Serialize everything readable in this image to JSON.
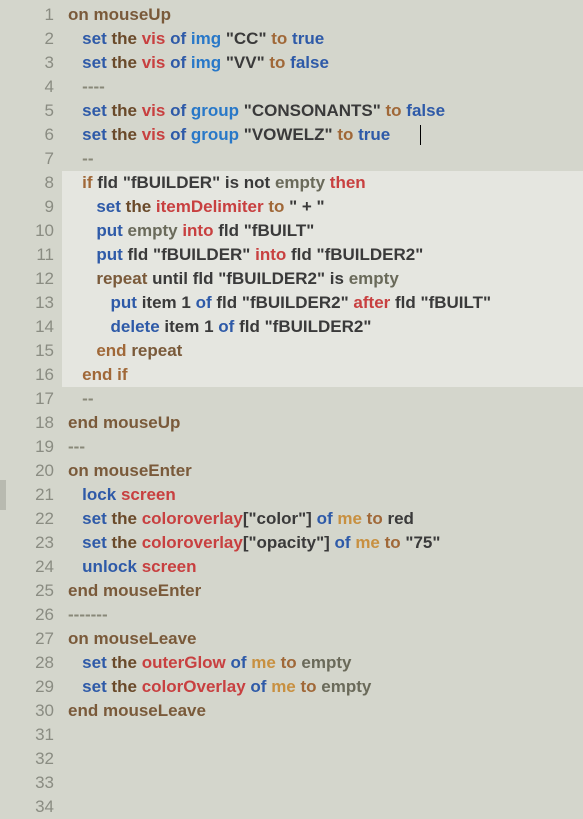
{
  "gutter": {
    "lines": [
      "1",
      "2",
      "3",
      "4",
      "5",
      "6",
      "7",
      "8",
      "9",
      "10",
      "11",
      "12",
      "13",
      "14",
      "15",
      "16",
      "17",
      "18",
      "19",
      "20",
      "21",
      "22",
      "23",
      "24",
      "25",
      "26",
      "27",
      "28",
      "29",
      "30",
      "31",
      "32",
      "33",
      "34"
    ]
  },
  "code": {
    "l1": {
      "on": "on",
      "name": "mouseUp"
    },
    "l2": {
      "set": "set",
      "the": "the",
      "prop": "vis",
      "of": "of",
      "type": "img",
      "str": "\"CC\"",
      "to": "to",
      "val": "true"
    },
    "l3": {
      "set": "set",
      "the": "the",
      "prop": "vis",
      "of": "of",
      "type": "img",
      "str": "\"VV\"",
      "to": "to",
      "val": "false"
    },
    "l4": {
      "c": "----"
    },
    "l5": {
      "set": "set",
      "the": "the",
      "prop": "vis",
      "of": "of",
      "type": "group",
      "str": "\"CONSONANTS\"",
      "to": "to",
      "val": "false"
    },
    "l6": {
      "set": "set",
      "the": "the",
      "prop": "vis",
      "of": "of",
      "type": "group",
      "str": "\"VOWELZ\"",
      "to": "to",
      "val": "true"
    },
    "l7": {
      "c": "--"
    },
    "l8": {
      "if": "if",
      "f1": "fld",
      "s1": "\"fBUILDER\"",
      "isn": "is not",
      "emp": "empty",
      "then": "then"
    },
    "l9": {
      "set": "set",
      "the": "the",
      "prop": "itemDelimiter",
      "to": "to",
      "str": "\" + \""
    },
    "l10": {
      "put": "put",
      "emp": "empty",
      "into": "into",
      "f": "fld",
      "s": "\"fBUILT\""
    },
    "l11": {
      "put": "put",
      "f1": "fld",
      "s1": "\"fBUILDER\"",
      "into": "into",
      "f2": "fld",
      "s2": "\"fBUILDER2\""
    },
    "l12": {
      "rep": "repeat",
      "until": "until",
      "f": "fld",
      "s": "\"fBUILDER2\"",
      "ise": "is",
      "emp": "empty"
    },
    "l13": {
      "put": "put",
      "item": "item",
      "n": "1",
      "of": "of",
      "f1": "fld",
      "s1": "\"fBUILDER2\"",
      "after": "after",
      "f2": "fld",
      "s2": "\"fBUILT\""
    },
    "l14": {
      "del": "delete",
      "item": "item",
      "n": "1",
      "of": "of",
      "f": "fld",
      "s": "\"fBUILDER2\""
    },
    "l15": {
      "end": "end",
      "w": "repeat"
    },
    "l16": {
      "end": "end",
      "w": "if"
    },
    "l17": {
      "c": "--"
    },
    "l18": {
      "end": "end",
      "name": "mouseUp"
    },
    "l19": {
      "c": "---"
    },
    "l20": {
      "on": "on",
      "name": "mouseEnter"
    },
    "l21": {
      "lock": "lock",
      "scr": "screen"
    },
    "l22": {
      "set": "set",
      "the": "the",
      "prop": "coloroverlay",
      "idx": "[\"color\"]",
      "of": "of",
      "me": "me",
      "to": "to",
      "val": "red"
    },
    "l23": {
      "set": "set",
      "the": "the",
      "prop": "coloroverlay",
      "idx": "[\"opacity\"]",
      "of": "of",
      "me": "me",
      "to": "to",
      "val": "\"75\""
    },
    "l24": {
      "unlock": "unlock",
      "scr": "screen"
    },
    "l25": {
      "end": "end",
      "name": "mouseEnter"
    },
    "l26": {
      "c": "-------"
    },
    "l27": {
      "on": "on",
      "name": "mouseLeave"
    },
    "l28": {
      "set": "set",
      "the": "the",
      "prop": "outerGlow",
      "of": "of",
      "me": "me",
      "to": "to",
      "val": "empty"
    },
    "l29": {
      "set": "set",
      "the": "the",
      "prop": "colorOverlay",
      "of": "of",
      "me": "me",
      "to": "to",
      "val": "empty"
    },
    "l30": {
      "end": "end",
      "name": "mouseLeave"
    }
  }
}
